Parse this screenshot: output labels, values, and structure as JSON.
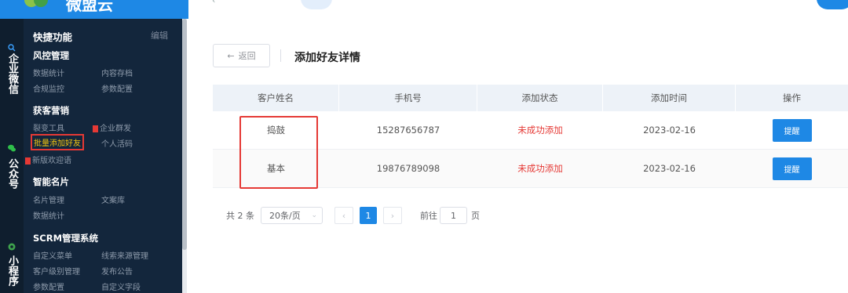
{
  "app": {
    "brand_text": "微盟云"
  },
  "rail": [
    {
      "label": "企业微信",
      "icon": "search-icon"
    },
    {
      "label": "公众号",
      "icon": "wechat-icon"
    },
    {
      "label": "小程序",
      "icon": "miniprogram-icon"
    }
  ],
  "menu": {
    "quick_title": "快捷功能",
    "edit_label": "编辑",
    "risk": {
      "title": "风控管理",
      "items": [
        "数据统计",
        "内容存档",
        "合规监控",
        "参数配置"
      ]
    },
    "acquire": {
      "title": "获客营销",
      "items": [
        "裂变工具",
        "企业群发",
        "批量添加好友",
        "个人活码",
        "新版欢迎语"
      ]
    },
    "card": {
      "title": "智能名片",
      "items": [
        "名片管理",
        "文案库",
        "数据统计"
      ]
    },
    "scrm": {
      "title": "SCRM管理系统",
      "items": [
        "自定义菜单",
        "线索来源管理",
        "客户级别管理",
        "发布公告",
        "参数配置",
        "自定义字段"
      ]
    }
  },
  "main": {
    "back_label": "返回",
    "back_icon": "arrow-left-icon",
    "title": "添加好友详情",
    "columns": [
      "客户姓名",
      "手机号",
      "添加状态",
      "添加时间",
      "操作"
    ],
    "rows": [
      {
        "name": "捣鼓",
        "phone": "15287656787",
        "status": "未成功添加",
        "time": "2023-02-16",
        "action": "提醒"
      },
      {
        "name": "基本",
        "phone": "19876789098",
        "status": "未成功添加",
        "time": "2023-02-16",
        "action": "提醒"
      }
    ],
    "pagination": {
      "total": "共 2 条",
      "page_size": "20条/页",
      "current": "1",
      "goto_label": "前往",
      "goto_value": "1",
      "page_suffix": "页"
    }
  },
  "colors": {
    "accent": "#1e88e5",
    "status_fail": "#e53935",
    "highlight": "#e53935"
  }
}
